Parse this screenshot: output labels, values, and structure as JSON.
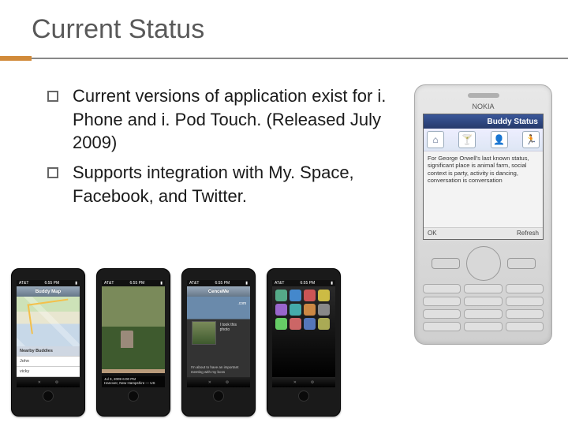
{
  "title": "Current Status",
  "bullets": [
    "Current versions of application exist for i. Phone and i. Pod Touch. (Released July 2009)",
    "Supports integration with My. Space, Facebook, and Twitter."
  ],
  "nokia": {
    "brand": "NOKIA",
    "screenTitle": "Buddy Status",
    "statusText": "For George Orwell's last known status, significant place is animal farm, social context is party, activity is dancing, conversation is conversation",
    "softkeyLeft": "OK",
    "softkeyRight": "Refresh",
    "iconNames": [
      "home-icon",
      "glass-icon",
      "profile-icon",
      "runner-icon"
    ]
  },
  "iphones": {
    "statusTime": "6:55 PM",
    "carrier": "AT&T",
    "screens": [
      {
        "navTitle": "Buddy Map",
        "listHeader": "Nearby Buddies",
        "listItems": [
          "John",
          "vicky"
        ]
      },
      {
        "navTitle": "",
        "captionLine1": "Jul 3, 2009 6:00 PM",
        "captionLine2": "Hanover, New Hampshire — US"
      },
      {
        "navTitle": "CenceMe",
        "detailTopText": ".com",
        "thumbLabel": "I took this photo",
        "note": "I'm about to have an important meeting with my boss"
      },
      {
        "navTitle": ""
      }
    ],
    "tabLabels": [
      "",
      "✕",
      "⚙",
      ""
    ]
  }
}
